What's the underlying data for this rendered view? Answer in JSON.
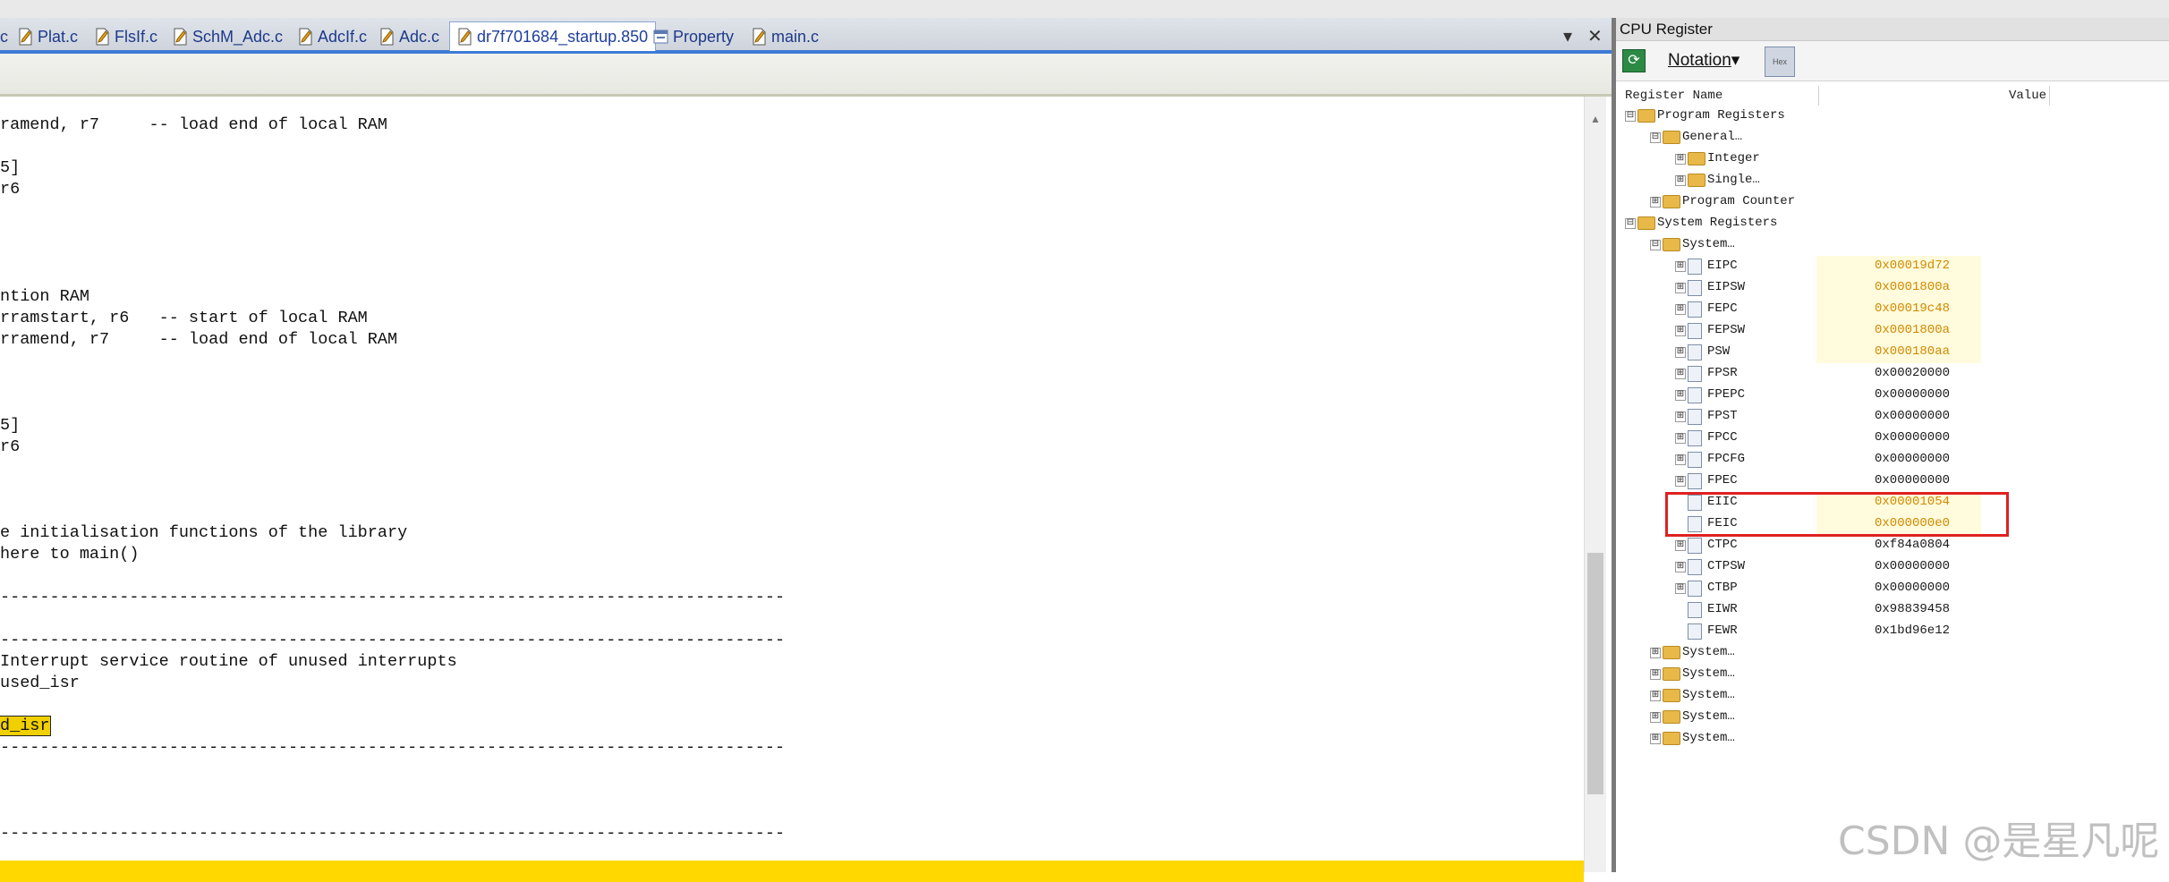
{
  "editor": {
    "tabs": [
      {
        "label": "c"
      },
      {
        "label": "Plat.c"
      },
      {
        "label": "FlsIf.c"
      },
      {
        "label": "SchM_Adc.c"
      },
      {
        "label": "AdcIf.c"
      },
      {
        "label": "Adc.c"
      },
      {
        "label": "dr7f701684_startup.850",
        "active": true
      },
      {
        "label": "Property"
      },
      {
        "label": "main.c"
      }
    ],
    "tab_controls": {
      "dropdown": "▾",
      "close": "✕"
    },
    "code_lines": [
      "ramend, r7     -- load end of local RAM",
      "",
      "5]",
      "r6",
      "",
      "",
      "",
      "",
      "ntion RAM",
      "rramstart, r6   -- start of local RAM",
      "rramend, r7     -- load end of local RAM",
      "",
      "",
      "",
      "5]",
      "r6",
      "",
      "",
      "",
      "e initialisation functions of the library",
      "here to main()",
      "",
      "-------------------------------------------------------------------------------",
      "",
      "-------------------------------------------------------------------------------",
      "Interrupt service routine of unused interrupts",
      "used_isr",
      "",
      "d_isr",
      "-------------------------------------------------------------------------------",
      "",
      "",
      "",
      "-------------------------------------------------------------------------------"
    ],
    "highlighted_line_index": 28
  },
  "registers": {
    "title": "CPU Register",
    "toolbar": {
      "notation_label": "Notation",
      "notation_arrow": "▾",
      "hex_label": "Hex"
    },
    "columns": {
      "name": "Register Name",
      "value": "Value"
    },
    "rows": [
      {
        "label": "Program Registers",
        "level": 0,
        "kind": "folder",
        "expander": "⊟"
      },
      {
        "label": "General…",
        "level": 1,
        "kind": "folder",
        "expander": "⊟"
      },
      {
        "label": "Integer",
        "level": 2,
        "kind": "folder",
        "expander": "⊞"
      },
      {
        "label": "Single…",
        "level": 2,
        "kind": "folder",
        "expander": "⊞"
      },
      {
        "label": "Program Counter",
        "level": 1,
        "kind": "folder",
        "expander": "⊞"
      },
      {
        "label": "System Registers",
        "level": 0,
        "kind": "folder",
        "expander": "⊟"
      },
      {
        "label": "System…",
        "level": 1,
        "kind": "folder",
        "expander": "⊟"
      },
      {
        "label": "EIPC",
        "level": 2,
        "kind": "reg",
        "expander": "⊞",
        "value": "0x00019d72",
        "changed": true
      },
      {
        "label": "EIPSW",
        "level": 2,
        "kind": "reg",
        "expander": "⊞",
        "value": "0x0001800a",
        "changed": true
      },
      {
        "label": "FEPC",
        "level": 2,
        "kind": "reg",
        "expander": "⊞",
        "value": "0x00019c48",
        "changed": true
      },
      {
        "label": "FEPSW",
        "level": 2,
        "kind": "reg",
        "expander": "⊞",
        "value": "0x0001800a",
        "changed": true
      },
      {
        "label": "PSW",
        "level": 2,
        "kind": "reg",
        "expander": "⊞",
        "value": "0x000180aa",
        "changed": true
      },
      {
        "label": "FPSR",
        "level": 2,
        "kind": "reg",
        "expander": "⊞",
        "value": "0x00020000"
      },
      {
        "label": "FPEPC",
        "level": 2,
        "kind": "reg",
        "expander": "⊞",
        "value": "0x00000000"
      },
      {
        "label": "FPST",
        "level": 2,
        "kind": "reg",
        "expander": "⊞",
        "value": "0x00000000"
      },
      {
        "label": "FPCC",
        "level": 2,
        "kind": "reg",
        "expander": "⊞",
        "value": "0x00000000"
      },
      {
        "label": "FPCFG",
        "level": 2,
        "kind": "reg",
        "expander": "⊞",
        "value": "0x00000000"
      },
      {
        "label": "FPEC",
        "level": 2,
        "kind": "reg",
        "expander": "⊞",
        "value": "0x00000000"
      },
      {
        "label": "EIIC",
        "level": 2,
        "kind": "reg",
        "expander": "",
        "value": "0x00001054",
        "changed": true
      },
      {
        "label": "FEIC",
        "level": 2,
        "kind": "reg",
        "expander": "",
        "value": "0x000000e0",
        "changed": true
      },
      {
        "label": "CTPC",
        "level": 2,
        "kind": "reg",
        "expander": "⊞",
        "value": "0xf84a0804"
      },
      {
        "label": "CTPSW",
        "level": 2,
        "kind": "reg",
        "expander": "⊞",
        "value": "0x00000000"
      },
      {
        "label": "CTBP",
        "level": 2,
        "kind": "reg",
        "expander": "⊞",
        "value": "0x00000000"
      },
      {
        "label": "EIWR",
        "level": 2,
        "kind": "reg",
        "expander": "",
        "value": "0x98839458"
      },
      {
        "label": "FEWR",
        "level": 2,
        "kind": "reg",
        "expander": "",
        "value": "0x1bd96e12"
      },
      {
        "label": "System…",
        "level": 1,
        "kind": "folder",
        "expander": "⊞"
      },
      {
        "label": "System…",
        "level": 1,
        "kind": "folder",
        "expander": "⊞"
      },
      {
        "label": "System…",
        "level": 1,
        "kind": "folder",
        "expander": "⊞"
      },
      {
        "label": "System…",
        "level": 1,
        "kind": "folder",
        "expander": "⊞"
      },
      {
        "label": "System…",
        "level": 1,
        "kind": "folder",
        "expander": "⊞"
      }
    ]
  },
  "watermark": "CSDN @是星凡呢",
  "colors": {
    "accent": "#3d7bd6",
    "highlight": "#ffd800",
    "changed_value": "#d08a00",
    "annotation_box": "#e02020"
  }
}
